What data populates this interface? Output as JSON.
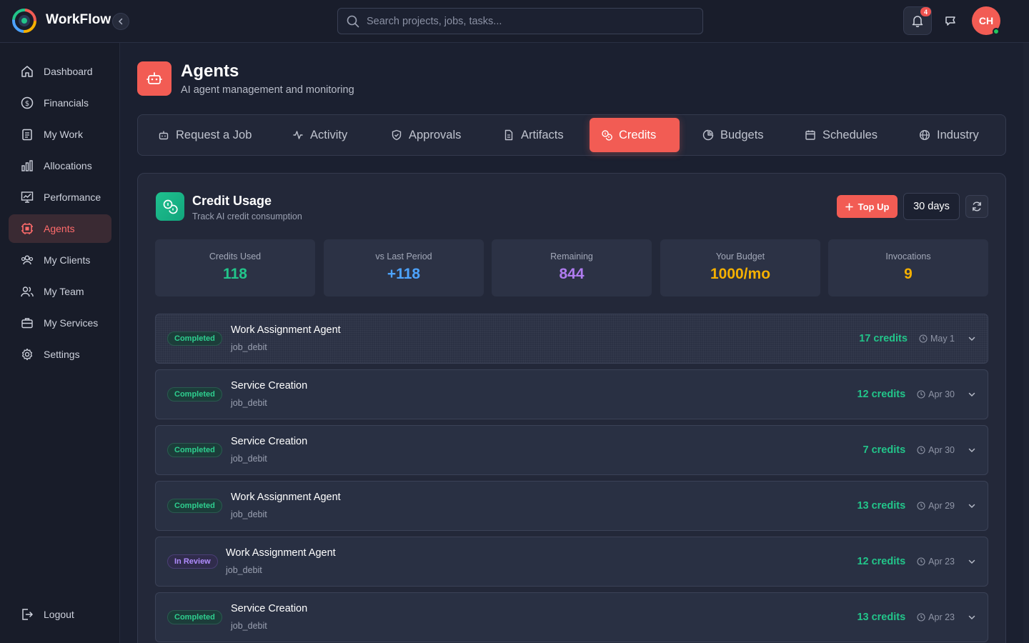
{
  "app": {
    "brand": "WorkFlow"
  },
  "search": {
    "placeholder": "Search projects, jobs, tasks..."
  },
  "header": {
    "notification_count": "4",
    "avatar_initials": "CH"
  },
  "sidebar": {
    "items": [
      {
        "label": "Dashboard",
        "icon": "home-icon"
      },
      {
        "label": "Financials",
        "icon": "dollar-icon"
      },
      {
        "label": "My Work",
        "icon": "clipboard-icon"
      },
      {
        "label": "Allocations",
        "icon": "bar-chart-icon"
      },
      {
        "label": "Performance",
        "icon": "presentation-chart-icon"
      },
      {
        "label": "Agents",
        "icon": "chip-icon",
        "active": true
      },
      {
        "label": "My Clients",
        "icon": "users-icon"
      },
      {
        "label": "My Team",
        "icon": "team-icon"
      },
      {
        "label": "My Services",
        "icon": "briefcase-icon"
      },
      {
        "label": "Settings",
        "icon": "gear-icon"
      }
    ],
    "logout": "Logout"
  },
  "page": {
    "title": "Agents",
    "subtitle": "AI agent management and monitoring"
  },
  "tabs": [
    {
      "label": "Request a Job",
      "icon": "bot-icon"
    },
    {
      "label": "Activity",
      "icon": "activity-icon"
    },
    {
      "label": "Approvals",
      "icon": "shield-check-icon"
    },
    {
      "label": "Artifacts",
      "icon": "file-icon"
    },
    {
      "label": "Credits",
      "icon": "coins-icon",
      "active": true
    },
    {
      "label": "Budgets",
      "icon": "pie-icon"
    },
    {
      "label": "Schedules",
      "icon": "calendar-icon"
    },
    {
      "label": "Industry",
      "icon": "globe-icon"
    }
  ],
  "credit_usage": {
    "title": "Credit Usage",
    "subtitle": "Track AI credit consumption",
    "top_up_label": "Top Up",
    "range_label": "30 days",
    "stats": [
      {
        "label": "Credits Used",
        "value": "118",
        "color": "#22c58a"
      },
      {
        "label": "vs Last Period",
        "value": "+118",
        "color": "#4da3ff"
      },
      {
        "label": "Remaining",
        "value": "844",
        "color": "#b07cf0"
      },
      {
        "label": "Your Budget",
        "value": "1000/mo",
        "color": "#f5b000"
      },
      {
        "label": "Invocations",
        "value": "9",
        "color": "#f5b000"
      }
    ],
    "entries": [
      {
        "status": "Completed",
        "title": "Work Assignment Agent",
        "type": "job_debit",
        "credits": "17 credits",
        "date": "May 1"
      },
      {
        "status": "Completed",
        "title": "Service Creation",
        "type": "job_debit",
        "credits": "12 credits",
        "date": "Apr 30"
      },
      {
        "status": "Completed",
        "title": "Service Creation",
        "type": "job_debit",
        "credits": "7 credits",
        "date": "Apr 30"
      },
      {
        "status": "Completed",
        "title": "Work Assignment Agent",
        "type": "job_debit",
        "credits": "13 credits",
        "date": "Apr 29"
      },
      {
        "status": "In Review",
        "title": "Work Assignment Agent",
        "type": "job_debit",
        "credits": "12 credits",
        "date": "Apr 23"
      },
      {
        "status": "Completed",
        "title": "Service Creation",
        "type": "job_debit",
        "credits": "13 credits",
        "date": "Apr 23"
      }
    ]
  }
}
